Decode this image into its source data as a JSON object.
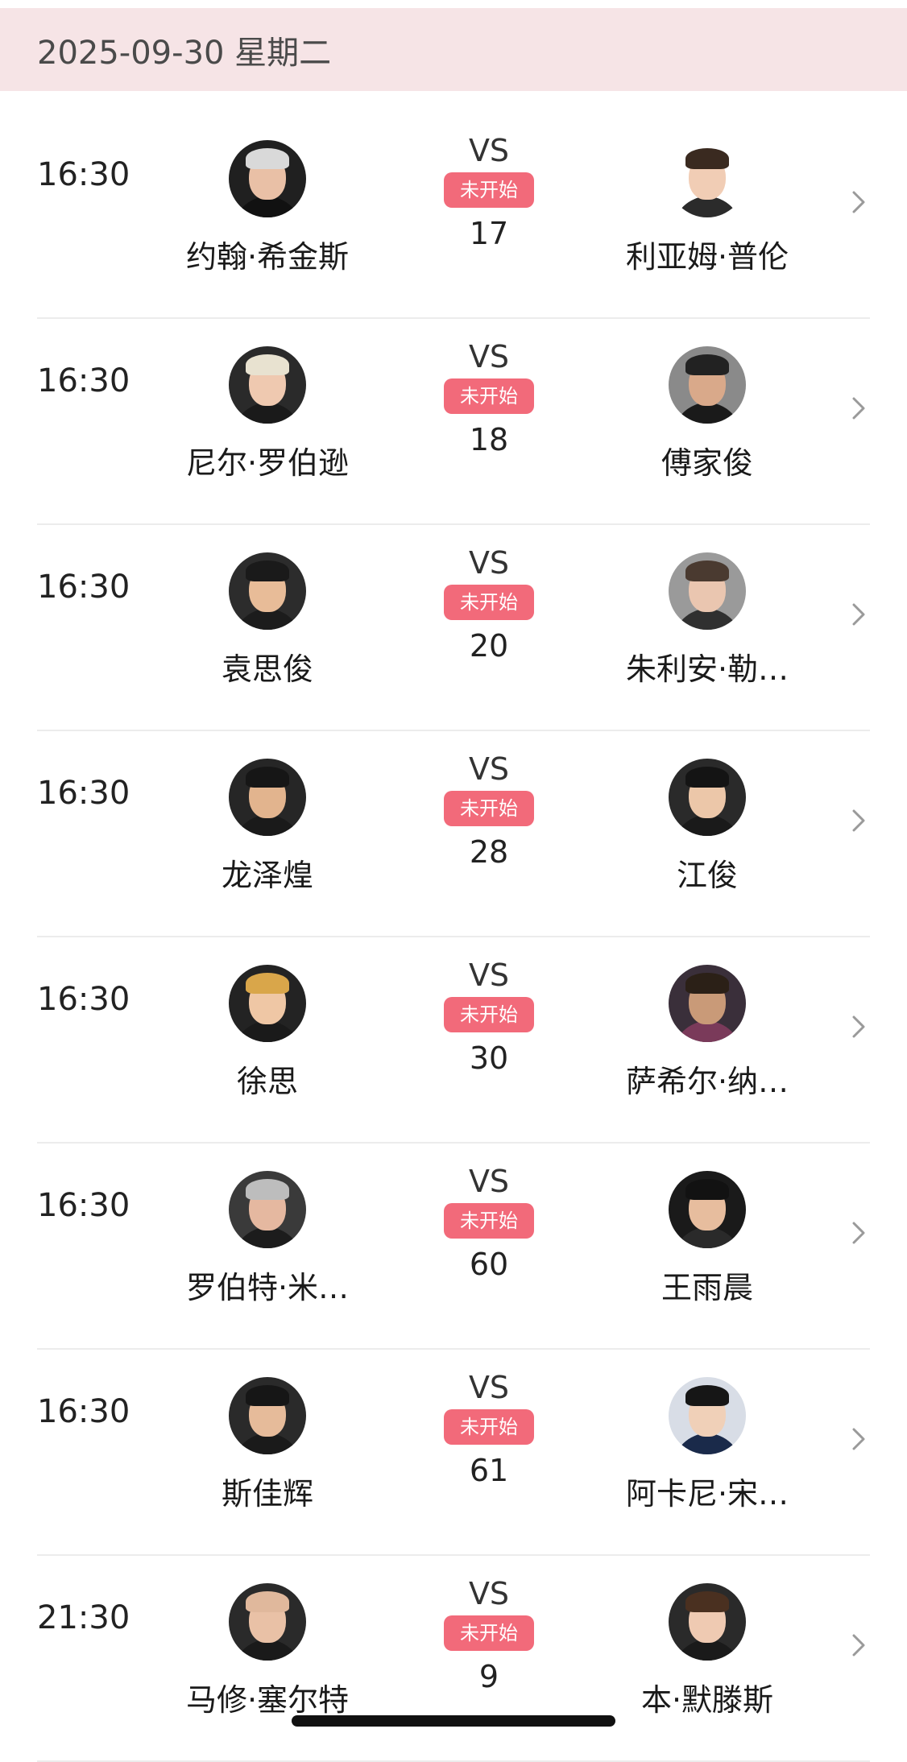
{
  "date_header": "2025-09-30 星期二",
  "vs_label": "VS",
  "matches": [
    {
      "time": "16:30",
      "home": {
        "name": "约翰·希金斯",
        "avatar": "avatar-icon",
        "skin": "#e9c0a6",
        "hair": "#d9d9d9",
        "bg": "#202020",
        "shirt": "#111111"
      },
      "away": {
        "name": "利亚姆·普伦",
        "avatar": "avatar-icon",
        "skin": "#f1cdb5",
        "hair": "#3a2a20",
        "bg": "#ffffff",
        "shirt": "#2b2b2b"
      },
      "status": "未开始",
      "round": "17"
    },
    {
      "time": "16:30",
      "home": {
        "name": "尼尔·罗伯逊",
        "avatar": "avatar-icon",
        "skin": "#efc9b0",
        "hair": "#e8e2d0",
        "bg": "#2a2a2a",
        "shirt": "#1a1a1a"
      },
      "away": {
        "name": "傅家俊",
        "avatar": "avatar-icon",
        "skin": "#d9a98a",
        "hair": "#222222",
        "bg": "#8a8a8a",
        "shirt": "#1a1a1a"
      },
      "status": "未开始",
      "round": "18"
    },
    {
      "time": "16:30",
      "home": {
        "name": "袁思俊",
        "avatar": "avatar-icon",
        "skin": "#e8bc98",
        "hair": "#1a1a1a",
        "bg": "#2c2c2c",
        "shirt": "#1c1c1c"
      },
      "away": {
        "name": "朱利安·勒…",
        "avatar": "avatar-icon",
        "skin": "#eac6b0",
        "hair": "#4a3a30",
        "bg": "#9a9a9a",
        "shirt": "#303030"
      },
      "status": "未开始",
      "round": "20"
    },
    {
      "time": "16:30",
      "home": {
        "name": "龙泽煌",
        "avatar": "avatar-icon",
        "skin": "#e2b48e",
        "hair": "#161616",
        "bg": "#262626",
        "shirt": "#1a1a1a"
      },
      "away": {
        "name": "江俊",
        "avatar": "avatar-icon",
        "skin": "#ecc7a9",
        "hair": "#141414",
        "bg": "#2a2a2a",
        "shirt": "#1a1a1a"
      },
      "status": "未开始",
      "round": "28"
    },
    {
      "time": "16:30",
      "home": {
        "name": "徐思",
        "avatar": "avatar-icon",
        "skin": "#efc7a5",
        "hair": "#d9a64a",
        "bg": "#232323",
        "shirt": "#1a1a1a"
      },
      "away": {
        "name": "萨希尔·纳…",
        "avatar": "avatar-icon",
        "skin": "#c99a78",
        "hair": "#2b2017",
        "bg": "#3a2f3a",
        "shirt": "#7a3a5a"
      },
      "status": "未开始",
      "round": "30"
    },
    {
      "time": "16:30",
      "home": {
        "name": "罗伯特·米…",
        "avatar": "avatar-icon",
        "skin": "#e5b8a0",
        "hair": "#bdbdbd",
        "bg": "#3a3a3a",
        "shirt": "#1c1c1c"
      },
      "away": {
        "name": "王雨晨",
        "avatar": "avatar-icon",
        "skin": "#e7bd9e",
        "hair": "#121212",
        "bg": "#1a1a1a",
        "shirt": "#2a2a2a"
      },
      "status": "未开始",
      "round": "60"
    },
    {
      "time": "16:30",
      "home": {
        "name": "斯佳辉",
        "avatar": "avatar-icon",
        "skin": "#e6bb9a",
        "hair": "#161616",
        "bg": "#2a2a2a",
        "shirt": "#1a1a1a"
      },
      "away": {
        "name": "阿卡尼·宋…",
        "avatar": "avatar-icon",
        "skin": "#f0d0b8",
        "hair": "#161616",
        "bg": "#d8dde6",
        "shirt": "#1a2a4a"
      },
      "status": "未开始",
      "round": "61"
    },
    {
      "time": "21:30",
      "home": {
        "name": "马修·塞尔特",
        "avatar": "avatar-icon",
        "skin": "#e9c1a6",
        "hair": "#e0b89c",
        "bg": "#2a2a2a",
        "shirt": "#1a1a1a"
      },
      "away": {
        "name": "本·默滕斯",
        "avatar": "avatar-icon",
        "skin": "#efcab2",
        "hair": "#4a3020",
        "bg": "#2a2a2a",
        "shirt": "#1a1a1a"
      },
      "status": "未开始",
      "round": "9"
    }
  ],
  "colors": {
    "header_bg": "#f6e4e6",
    "status_bg": "#f26a7a",
    "chevron": "#9a9a9a"
  },
  "icons": {
    "row_chevron": "chevron-right-icon"
  }
}
